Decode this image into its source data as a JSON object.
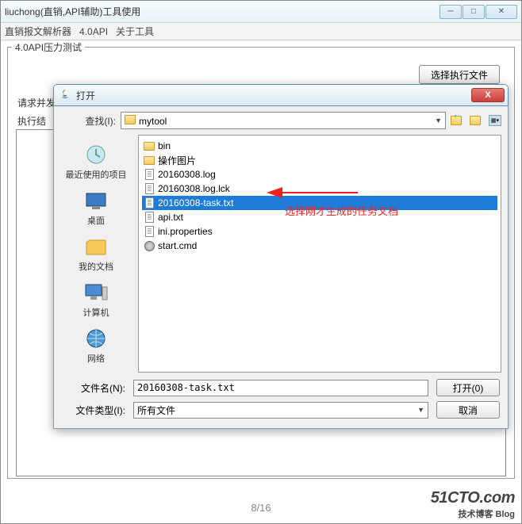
{
  "main_window": {
    "title": "liuchong(直销,API辅助)工具使用",
    "menu": {
      "item1": "直销报文解析器",
      "item2": "4.0API",
      "item3": "关于工具"
    },
    "tab_label": "4.0API压力测试",
    "select_exec_btn": "选择执行文件",
    "request_label": "请求并发",
    "exec_result_label": "执行结"
  },
  "dialog": {
    "title": "打开",
    "lookin_label": "查找(I):",
    "lookin_value": "mytool",
    "places": {
      "recent": "最近使用的项目",
      "desktop": "桌面",
      "documents": "我的文档",
      "computer": "计算机",
      "network": "网络"
    },
    "files": [
      {
        "name": "bin",
        "type": "folder"
      },
      {
        "name": "操作图片",
        "type": "folder"
      },
      {
        "name": "20160308.log",
        "type": "file"
      },
      {
        "name": "20160308.log.lck",
        "type": "file"
      },
      {
        "name": "20160308-task.txt",
        "type": "file",
        "selected": true
      },
      {
        "name": "api.txt",
        "type": "file"
      },
      {
        "name": "ini.properties",
        "type": "file"
      },
      {
        "name": "start.cmd",
        "type": "gear"
      }
    ],
    "filename_label": "文件名(N):",
    "filename_value": "20160308-task.txt",
    "filetype_label": "文件类型(I):",
    "filetype_value": "所有文件",
    "open_btn": "打开(0)",
    "cancel_btn": "取消"
  },
  "annotation": "选择刚才生成的任务文档",
  "pagenum": "8/16",
  "watermark": {
    "line1": "51CTO.com",
    "line2": "技术博客      Blog"
  }
}
